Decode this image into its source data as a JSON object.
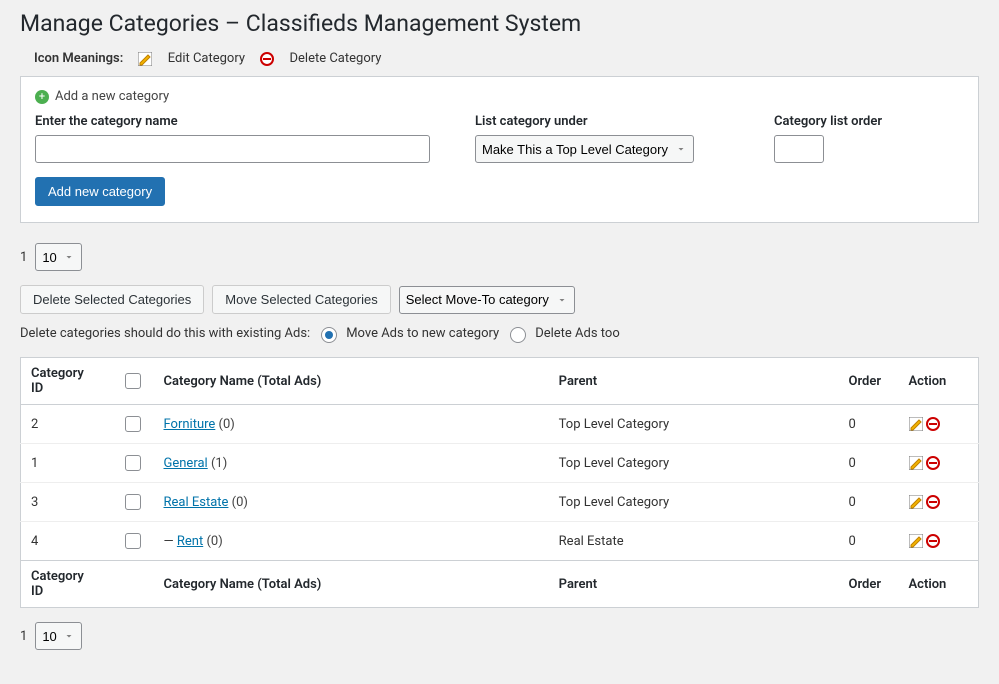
{
  "pageTitle": "Manage Categories – Classifieds Management System",
  "iconMeanings": {
    "label": "Icon Meanings:",
    "edit": "Edit Category",
    "delete": "Delete Category"
  },
  "addPanel": {
    "title": "Add a new category",
    "nameLabel": "Enter the category name",
    "parentLabel": "List category under",
    "orderLabel": "Category list order",
    "parentOption": "Make This a Top Level Category",
    "submit": "Add new category"
  },
  "pager": {
    "page": "1",
    "perPage": "10"
  },
  "bulk": {
    "deleteLabel": "Delete Selected Categories",
    "moveLabel": "Move Selected Categories",
    "moveToOption": "Select Move-To category"
  },
  "deleteOptions": {
    "prompt": "Delete categories should do this with existing Ads:",
    "move": "Move Ads to new category",
    "delete": "Delete Ads too"
  },
  "table": {
    "headers": {
      "id": "Category ID",
      "name": "Category Name (Total Ads)",
      "parent": "Parent",
      "order": "Order",
      "action": "Action"
    },
    "rows": [
      {
        "id": "2",
        "name": "Forniture",
        "count": "(0)",
        "indent": "",
        "parent": "Top Level Category",
        "order": "0"
      },
      {
        "id": "1",
        "name": "General",
        "count": "(1)",
        "indent": "",
        "parent": "Top Level Category",
        "order": "0"
      },
      {
        "id": "3",
        "name": "Real Estate",
        "count": "(0)",
        "indent": "",
        "parent": "Top Level Category",
        "order": "0"
      },
      {
        "id": "4",
        "name": "Rent",
        "count": "(0)",
        "indent": "— ",
        "parent": "Real Estate",
        "order": "0"
      }
    ]
  }
}
